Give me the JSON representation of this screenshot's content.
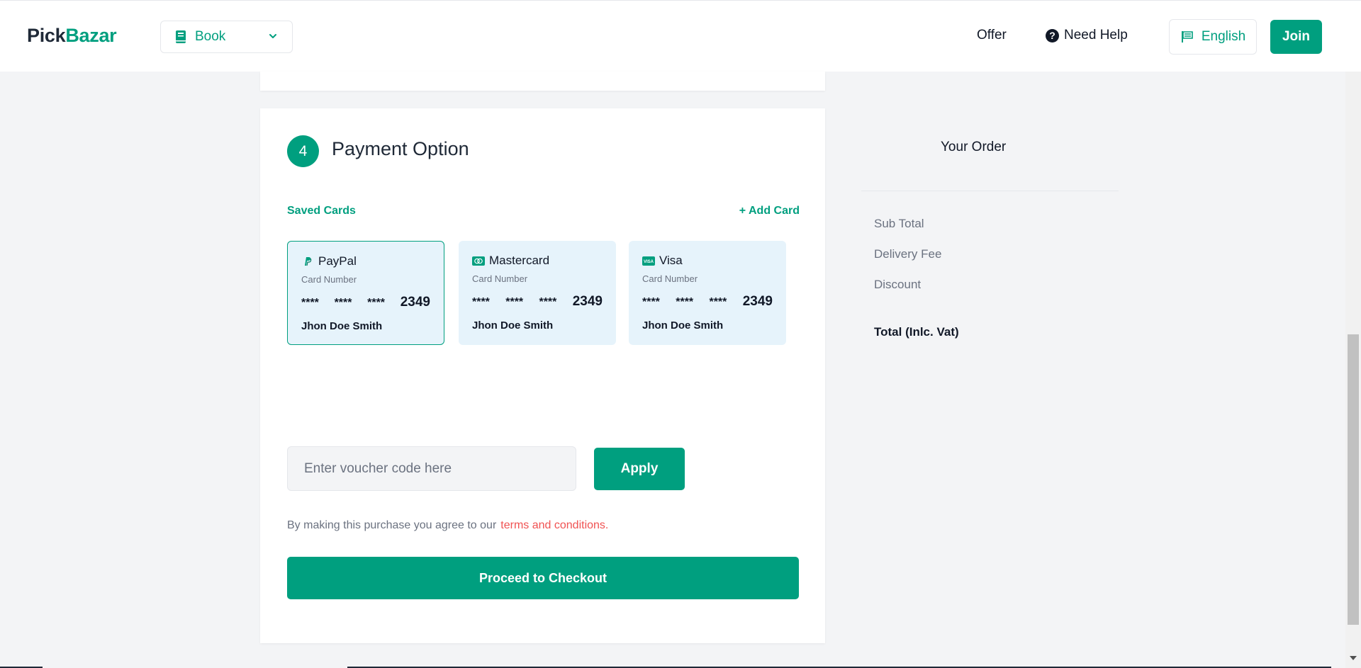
{
  "header": {
    "logo_part1": "Pick",
    "logo_part2": "Bazar",
    "type_select": "Book",
    "nav_offer": "Offer",
    "nav_help": "Need Help",
    "language": "English",
    "join": "Join"
  },
  "payment": {
    "step_number": "4",
    "title": "Payment Option",
    "saved_cards_label": "Saved Cards",
    "add_card_label": "+ Add Card",
    "cards": [
      {
        "brand": "PayPal",
        "icon": "paypal-icon",
        "number_label": "Card Number",
        "mask1": "****",
        "mask2": "****",
        "mask3": "****",
        "last4": "2349",
        "holder": "Jhon Doe Smith",
        "selected": true
      },
      {
        "brand": "Mastercard",
        "icon": "mastercard-icon",
        "number_label": "Card Number",
        "mask1": "****",
        "mask2": "****",
        "mask3": "****",
        "last4": "2349",
        "holder": "Jhon Doe Smith",
        "selected": false
      },
      {
        "brand": "Visa",
        "icon": "visa-icon",
        "number_label": "Card Number",
        "mask1": "****",
        "mask2": "****",
        "mask3": "****",
        "last4": "2349",
        "holder": "Jhon Doe Smith",
        "selected": false
      }
    ],
    "voucher_placeholder": "Enter voucher code here",
    "apply_label": "Apply",
    "terms_text": "By making this purchase you agree to our",
    "terms_link": "terms and conditions.",
    "checkout_label": "Proceed to Checkout"
  },
  "order": {
    "title": "Your Order",
    "sub_total": "Sub Total",
    "delivery_fee": "Delivery Fee",
    "discount": "Discount",
    "total": "Total (Inlc. Vat)"
  },
  "colors": {
    "accent": "#009f7f",
    "card_bg": "#e6f3fb",
    "link_red": "#f05252"
  }
}
